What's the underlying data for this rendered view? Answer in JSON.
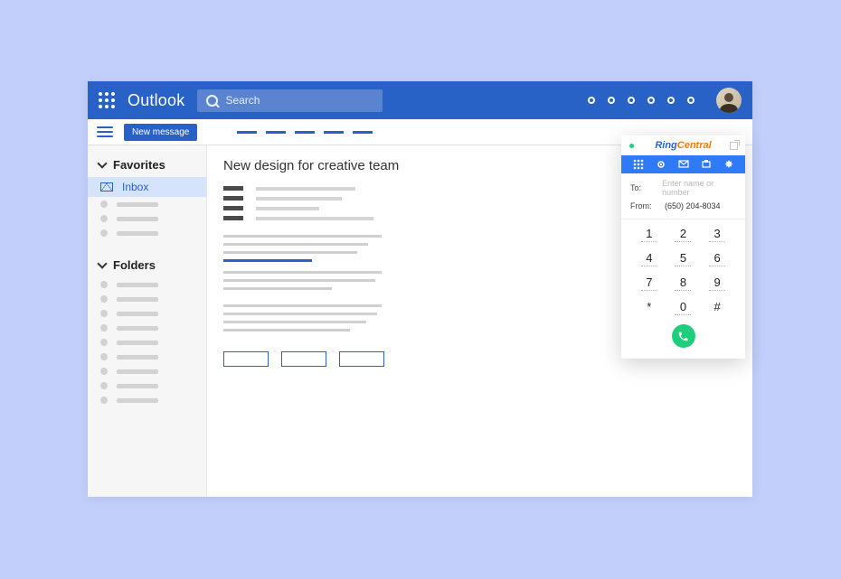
{
  "header": {
    "brand": "Outlook",
    "search_placeholder": "Search"
  },
  "subbar": {
    "new_message": "New message"
  },
  "sidebar": {
    "favorites_label": "Favorites",
    "folders_label": "Folders",
    "inbox_label": "Inbox"
  },
  "message": {
    "title": "New design for creative team"
  },
  "ringcentral": {
    "brand_a": "Ring",
    "brand_b": "Central",
    "to_label": "To:",
    "to_placeholder": "Enter name or number",
    "from_label": "From:",
    "from_value": "(650) 204-8034",
    "keys": [
      "1",
      "2",
      "3",
      "4",
      "5",
      "6",
      "7",
      "8",
      "9",
      "*",
      "0",
      "#"
    ]
  }
}
